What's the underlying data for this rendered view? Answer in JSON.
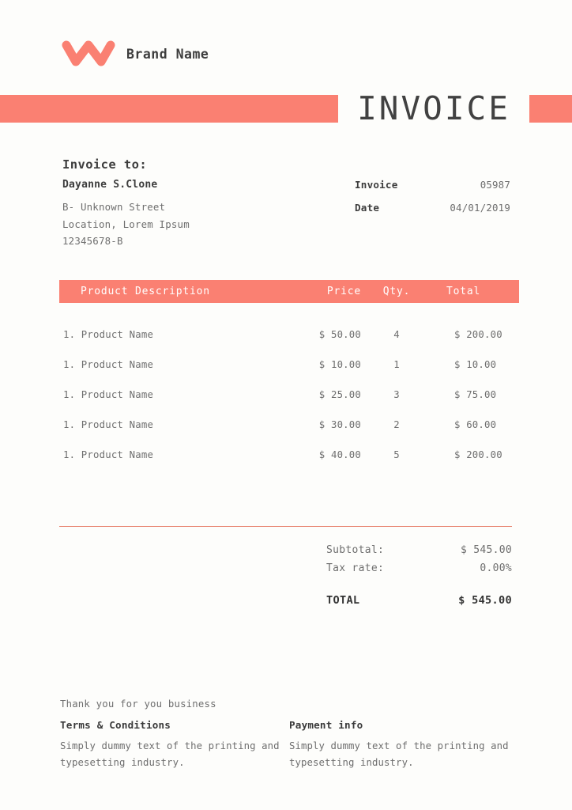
{
  "brand": {
    "logo_icon": "w-zigzag-logo-icon",
    "name": "Brand Name",
    "accent_color": "#FA8072"
  },
  "header": {
    "title": "INVOICE"
  },
  "bill_to": {
    "heading": "Invoice to:",
    "name": "Dayanne S.Clone",
    "address_lines": [
      "B- Unknown Street",
      "Location, Lorem Ipsum",
      "12345678-B"
    ]
  },
  "meta": {
    "rows": [
      {
        "label": "Invoice",
        "value": "05987"
      },
      {
        "label": "Date",
        "value": "04/01/2019"
      }
    ]
  },
  "table": {
    "columns": [
      "Product Description",
      "Price",
      "Qty.",
      "Total"
    ],
    "rows": [
      {
        "description": "1. Product Name",
        "price": "$ 50.00",
        "qty": "4",
        "total": "$ 200.00"
      },
      {
        "description": "1. Product Name",
        "price": "$ 10.00",
        "qty": "1",
        "total": "$ 10.00"
      },
      {
        "description": "1. Product Name",
        "price": "$ 25.00",
        "qty": "3",
        "total": "$ 75.00"
      },
      {
        "description": "1. Product Name",
        "price": "$ 30.00",
        "qty": "2",
        "total": "$ 60.00"
      },
      {
        "description": "1. Product Name",
        "price": "$ 40.00",
        "qty": "5",
        "total": "$ 200.00"
      }
    ]
  },
  "totals": {
    "subtotal_label": "Subtotal:",
    "subtotal_value": "$ 545.00",
    "tax_label": "Tax rate:",
    "tax_value": "0.00%",
    "grand_label": "TOTAL",
    "grand_value": "$ 545.00"
  },
  "footer": {
    "thanks": "Thank you for you business",
    "terms_title": "Terms & Conditions",
    "terms_text": "Simply dummy text of the printing and typesetting industry.",
    "payment_title": "Payment info",
    "payment_text": "Simply dummy text of the printing and typesetting industry."
  }
}
